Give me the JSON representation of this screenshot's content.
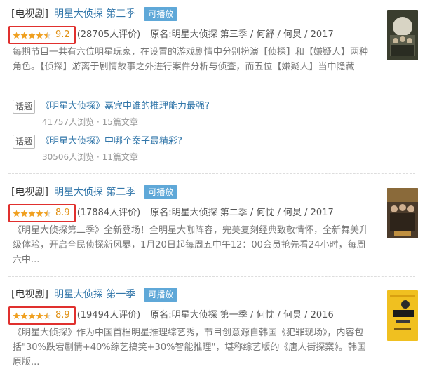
{
  "results": [
    {
      "category": "[电视剧]",
      "title": "明星大侦探 第三季",
      "badge": "可播放",
      "rating": 4.5,
      "score": "9.2",
      "votes": "(28705人评价)",
      "origin": "原名:明星大侦探 第三季 / 何舒 / 何炅 / 2017",
      "desc": "每期节目一共有六位明星玩家，在设置的游戏剧情中分别扮演【侦探】和【嫌疑人】两种角色。【侦探】游离于剧情故事之外进行案件分析与侦查，而五位【嫌疑人】当中隐藏着..."
    },
    {
      "category": "[电视剧]",
      "title": "明星大侦探 第二季",
      "badge": "可播放",
      "rating": 4.5,
      "score": "8.9",
      "votes": "(17884人评价)",
      "origin": "原名:明星大侦探 第二季 / 何忱 / 何炅 / 2017",
      "desc": "《明星大侦探第二季》全新登场！全明星大咖阵容，完美复刻经典致敬情怀，全新舞美升级体验，开启全民侦探新风暴，1月20日起每周五中午12：00会员抢先看24小时，每周六中..."
    },
    {
      "category": "[电视剧]",
      "title": "明星大侦探 第一季",
      "badge": "可播放",
      "rating": 4.5,
      "score": "8.9",
      "votes": "(19494人评价)",
      "origin": "原名:明星大侦探 第一季 / 何忱 / 何炅 / 2016",
      "desc": "《明星大侦探》作为中国首档明星推理综艺秀，节目创意源自韩国《犯罪现场》，内容包括\"30%跌宕剧情+40%综艺搞笑+30%智能推理\"，堪称综艺版的《唐人街探案》。韩国原版..."
    }
  ],
  "topics": [
    {
      "tag": "话题",
      "title": "《明星大侦探》嘉宾中谁的推理能力最强?",
      "meta": "41757人浏览 · 15篇文章"
    },
    {
      "tag": "话题",
      "title": "《明星大侦探》中哪个案子最精彩?",
      "meta": "30506人浏览 · 11篇文章"
    }
  ],
  "colors": {
    "link": "#3377aa",
    "badge": "#5fa8d8",
    "highlight_box": "#e0302e",
    "score": "#e09015",
    "star": "#f0a020"
  }
}
